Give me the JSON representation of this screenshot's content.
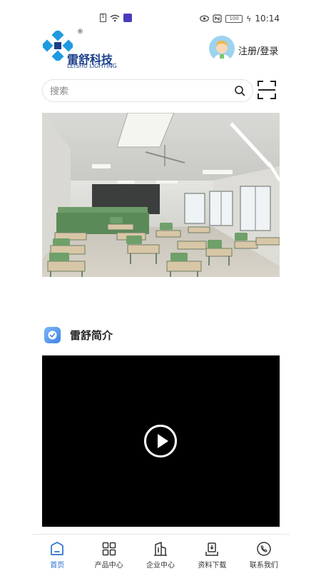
{
  "status_bar": {
    "time": "10:14",
    "battery": "100",
    "icons": [
      "sim-icon",
      "wifi-icon",
      "app-badge-icon",
      "eye-icon",
      "nfc-icon",
      "battery-icon",
      "charging-icon"
    ]
  },
  "header": {
    "logo_cn": "雷舒科技",
    "logo_en": "LEISHU LIGHTING",
    "logo_reg": "®",
    "login_label": "注册/登录"
  },
  "search": {
    "placeholder": "搜索"
  },
  "section": {
    "title": "雷舒简介"
  },
  "nav": {
    "items": [
      {
        "label": "首页",
        "icon": "home-icon",
        "active": true
      },
      {
        "label": "产品中心",
        "icon": "grid-icon",
        "active": false
      },
      {
        "label": "企业中心",
        "icon": "building-icon",
        "active": false
      },
      {
        "label": "资料下载",
        "icon": "download-icon",
        "active": false
      },
      {
        "label": "联系我们",
        "icon": "phone-icon",
        "active": false
      }
    ]
  },
  "colors": {
    "accent": "#2a6fd6",
    "logo_blue": "#1a3f8a",
    "logo_cyan": "#1e9be0"
  }
}
